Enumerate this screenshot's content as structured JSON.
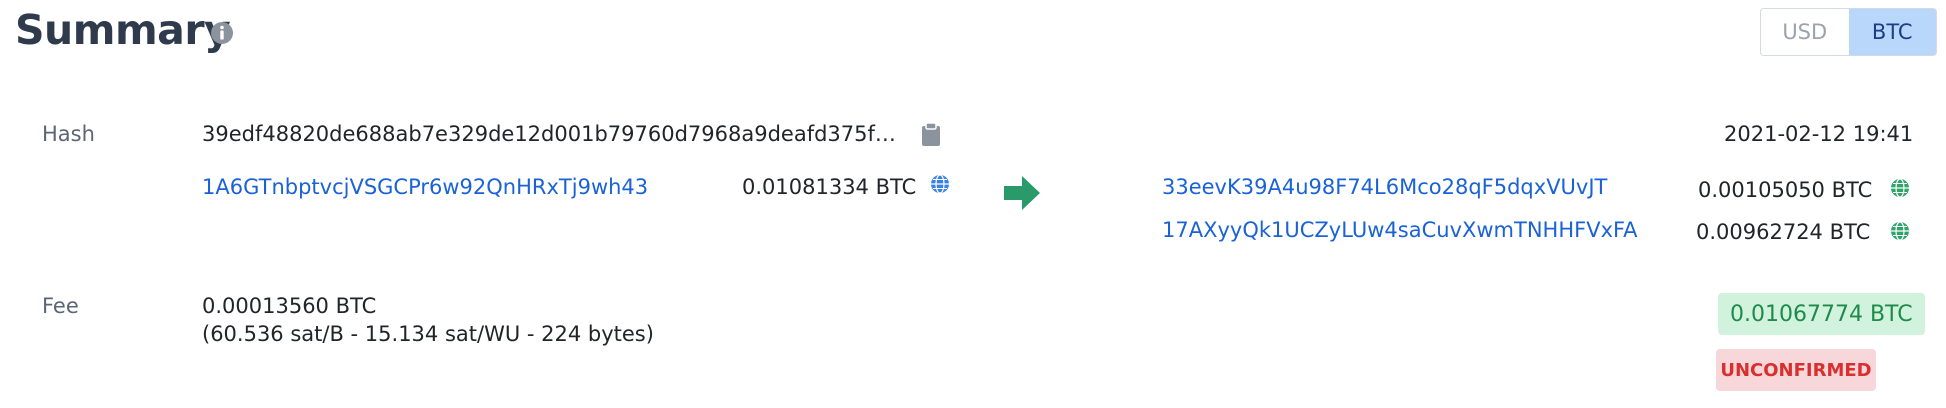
{
  "header": {
    "title": "Summary",
    "info_icon": "info-circle-icon",
    "currency_options": [
      "USD",
      "BTC"
    ],
    "currency_selected": "BTC"
  },
  "hash": {
    "label": "Hash",
    "value": "39edf48820de688ab7e329de12d001b79760d7968a9deafd375f…",
    "copy_icon": "clipboard-icon",
    "timestamp": "2021-02-12 19:41"
  },
  "inputs": [
    {
      "address": "1A6GTnbptvcjVSGCPr6w92QnHRxTj9wh43",
      "amount": "0.01081334 BTC",
      "icon": "globe-icon"
    }
  ],
  "outputs": [
    {
      "address": "33eevK39A4u98F74L6Mco28qF5dqxVUvJT",
      "amount": "0.00105050 BTC",
      "icon": "globe-icon"
    },
    {
      "address": "17AXyyQk1UCZyLUw4saCuvXwmTNHHFVxFA",
      "amount": "0.00962724 BTC",
      "icon": "globe-icon"
    }
  ],
  "flow_icon": "arrow-right-icon",
  "fee": {
    "label": "Fee",
    "value": "0.00013560 BTC",
    "details": "(60.536 sat/B - 15.134 sat/WU - 224 bytes)"
  },
  "total_amount": "0.01067774 BTC",
  "status": "UNCONFIRMED",
  "colors": {
    "title": "#2f3b4c",
    "link": "#1a62d6",
    "arrow": "#2a9a6a",
    "input_globe": "#3b82e6",
    "output_globe": "#2ea36a",
    "amount_badge_bg": "#d1f2dc",
    "amount_badge_text": "#1f8a4a",
    "status_bg": "#f8d7da",
    "status_text": "#d9302f",
    "toggle_active_bg": "#b9d7fb"
  }
}
